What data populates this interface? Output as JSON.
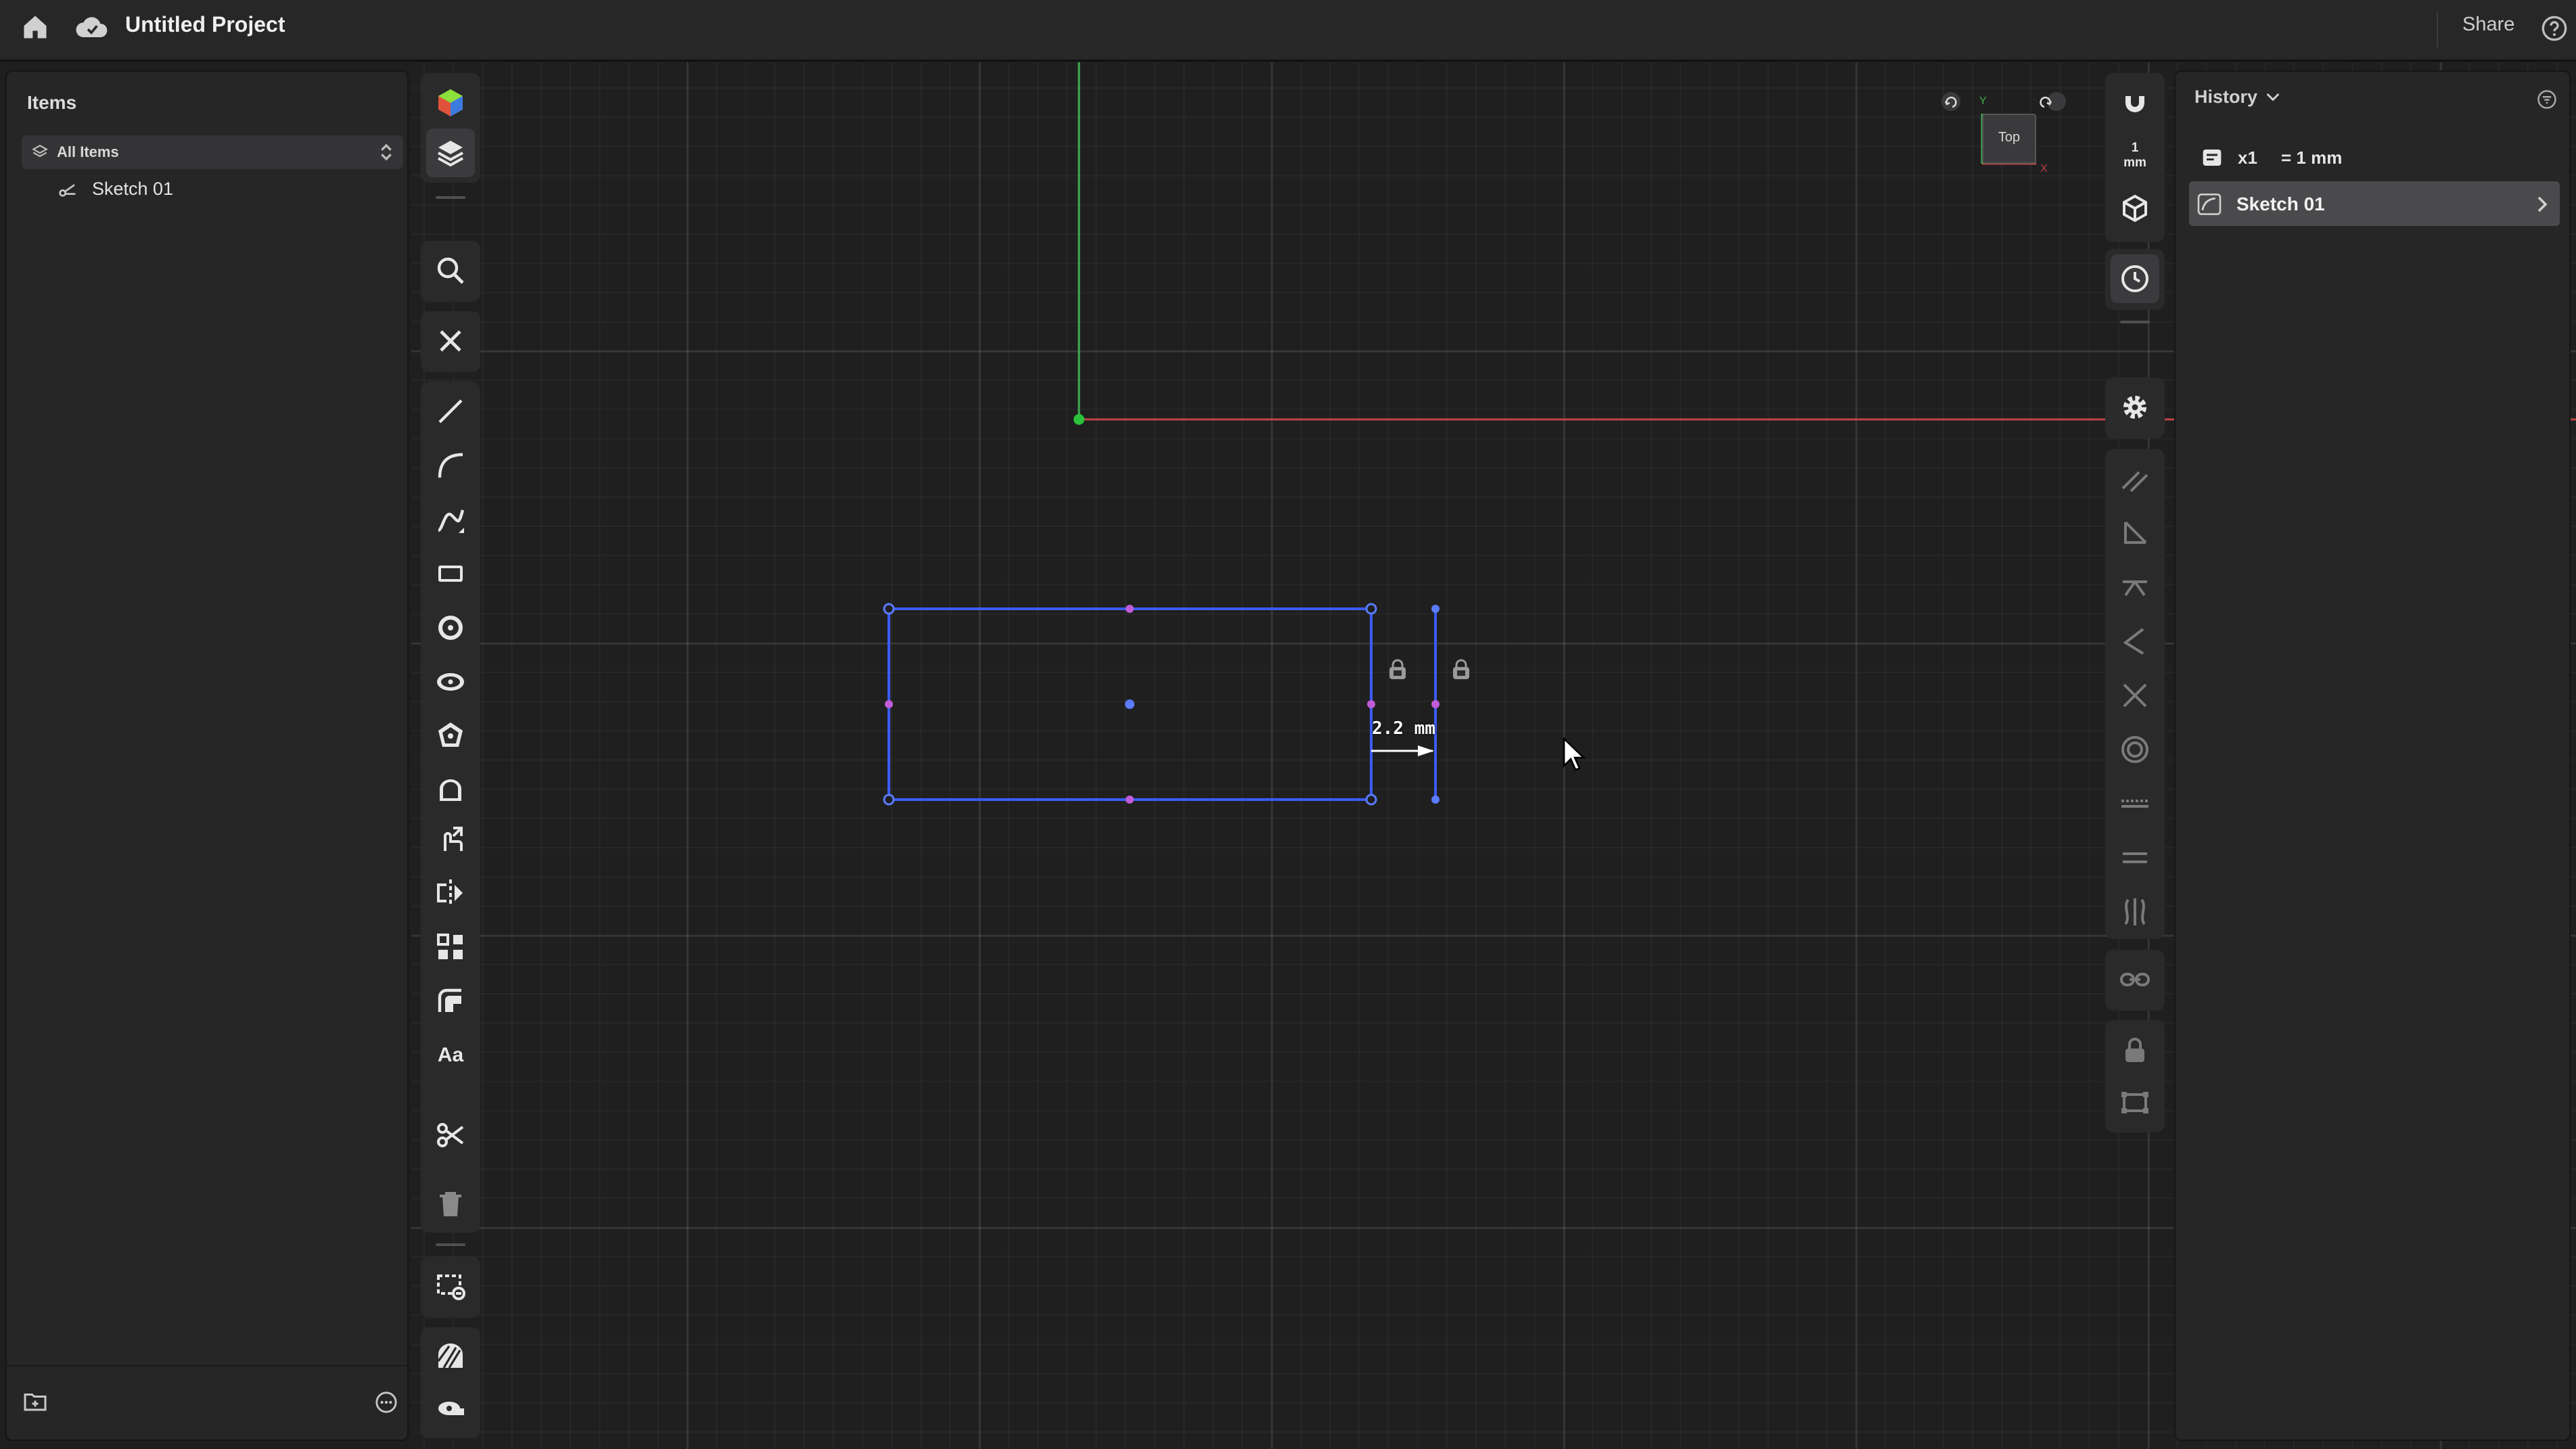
{
  "topbar": {
    "project_title": "Untitled Project",
    "share_label": "Share"
  },
  "items_panel": {
    "heading": "Items",
    "filter_label": "All Items",
    "tree": [
      {
        "label": "Sketch 01"
      }
    ]
  },
  "history_panel": {
    "heading": "History",
    "parameter": {
      "name": "x1",
      "value": "= 1 mm"
    },
    "items": [
      {
        "label": "Sketch 01"
      }
    ]
  },
  "view_cube": {
    "face_label": "Top",
    "axis_y": "Y",
    "axis_x": "X"
  },
  "left_toolbar": {
    "text_tool_label": "Aa"
  },
  "right_toolbar": {
    "grid_scale_value": "1",
    "grid_scale_unit": "mm"
  },
  "sketch": {
    "dimension_label": "2.2 mm"
  },
  "colors": {
    "selection": "#3d5cf5",
    "x_axis": "#c04545",
    "y_axis": "#3fb04f",
    "origin": "#29c23a",
    "midpoint": "#c05cd8"
  },
  "icons": {
    "top_left": [
      "home-icon",
      "cloud-icon"
    ],
    "left_tools": [
      "parts-icon",
      "layers-icon",
      "search-icon",
      "close-icon",
      "line-icon",
      "arc-icon",
      "spline-icon",
      "rectangle-icon",
      "circle-icon",
      "ellipse-icon",
      "polygon-icon",
      "slot-icon",
      "transform-icon",
      "mirror-icon",
      "pattern-icon",
      "offset-icon",
      "text-icon",
      "trim-icon",
      "delete-icon",
      "select-box-icon",
      "hatch-icon",
      "measure-icon"
    ],
    "right_tools": [
      "magnet-icon",
      "grid-scale-icon",
      "view-icon",
      "history-icon",
      "settings-icon",
      "parallel-icon",
      "perpendicular-icon",
      "horizontal-icon",
      "angle-icon",
      "intersect-icon",
      "concentric-icon",
      "dash-line-icon",
      "equal-icon",
      "symmetric-icon",
      "link-icon",
      "lock-icon",
      "bounding-box-icon"
    ]
  }
}
